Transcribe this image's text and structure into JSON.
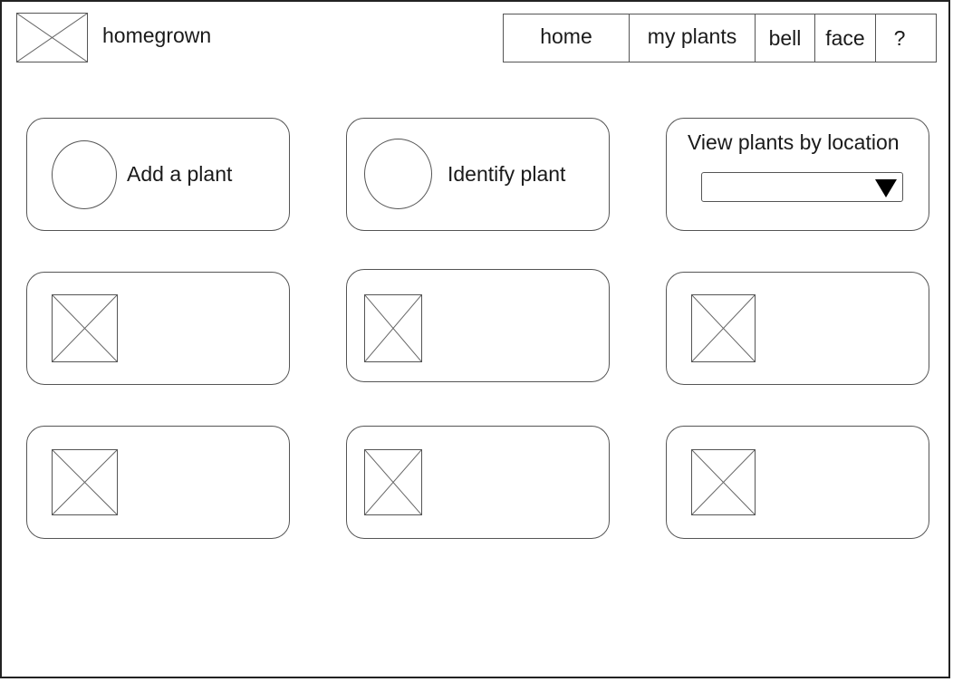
{
  "header": {
    "logo_icon": "image-placeholder-icon",
    "app_name": "homegrown"
  },
  "nav": {
    "items": [
      {
        "label": "home"
      },
      {
        "label": "my plants"
      },
      {
        "label": "bell"
      },
      {
        "label": "face"
      },
      {
        "label": "?"
      }
    ]
  },
  "actions": {
    "add_plant": {
      "label": "Add a plant",
      "icon": "circle-icon"
    },
    "identify_plant": {
      "label": "Identify plant",
      "icon": "circle-icon"
    },
    "location": {
      "label": "View plants by location",
      "selected": "",
      "icon": "triangle-down-icon"
    }
  },
  "plant_cards": [
    {
      "icon": "image-placeholder-icon"
    },
    {
      "icon": "image-placeholder-icon"
    },
    {
      "icon": "image-placeholder-icon"
    },
    {
      "icon": "image-placeholder-icon"
    },
    {
      "icon": "image-placeholder-icon"
    },
    {
      "icon": "image-placeholder-icon"
    }
  ]
}
